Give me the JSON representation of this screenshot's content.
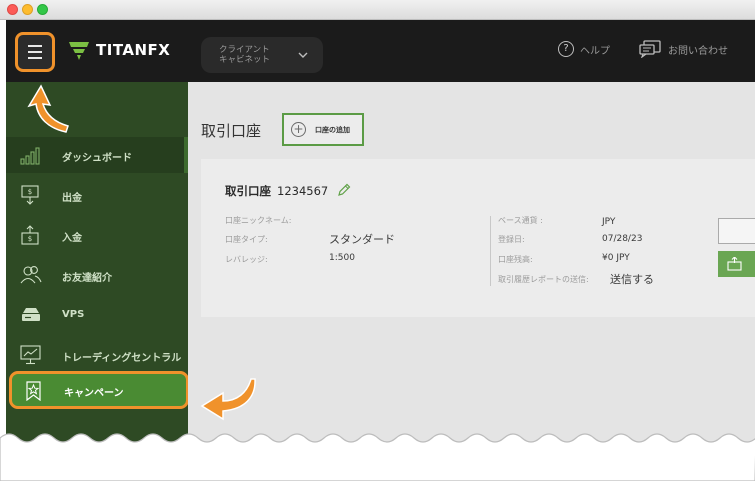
{
  "window": {
    "controls": [
      "close",
      "minimize",
      "maximize"
    ]
  },
  "topbar": {
    "logo_text": "TITAN",
    "logo_suffix": "FX",
    "client_selector": {
      "line1": "クライアント",
      "line2": "キャビネット"
    },
    "help_label": "ヘルプ",
    "contact_label": "お問い合わせ"
  },
  "sidebar": {
    "items": [
      {
        "label": "ダッシュボード",
        "icon": "bar-chart-icon",
        "active": true
      },
      {
        "label": "出金",
        "icon": "withdraw-icon"
      },
      {
        "label": "入金",
        "icon": "deposit-icon"
      },
      {
        "label": "お友達紹介",
        "icon": "users-icon"
      },
      {
        "label": "VPS",
        "icon": "server-icon"
      },
      {
        "label": "トレーディングセントラル",
        "icon": "monitor-chart-icon"
      },
      {
        "label": "キャンペーン",
        "icon": "ribbon-star-icon",
        "highlighted": true
      }
    ]
  },
  "main": {
    "page_title": "取引口座",
    "add_button_label": "口座の追加",
    "account": {
      "title": "取引口座",
      "number": "1234567",
      "left_fields": [
        {
          "label": "口座ニックネーム:",
          "value": ""
        },
        {
          "label": "口座タイプ:",
          "value": "スタンダード"
        },
        {
          "label": "レバレッジ:",
          "value": "1:500"
        }
      ],
      "right_fields": [
        {
          "label": "ベース通貨 :",
          "value": "JPY"
        },
        {
          "label": "登録日:",
          "value": "07/28/23"
        },
        {
          "label": "口座残高:",
          "value": "¥0 JPY"
        },
        {
          "label": "取引履歴レポートの送信:",
          "value": "送信する"
        }
      ]
    }
  },
  "colors": {
    "accent_orange": "#f0922b",
    "sidebar_green": "#2e4a24",
    "highlight_green": "#4a8b33",
    "topbar_black": "#1b1b1b"
  }
}
